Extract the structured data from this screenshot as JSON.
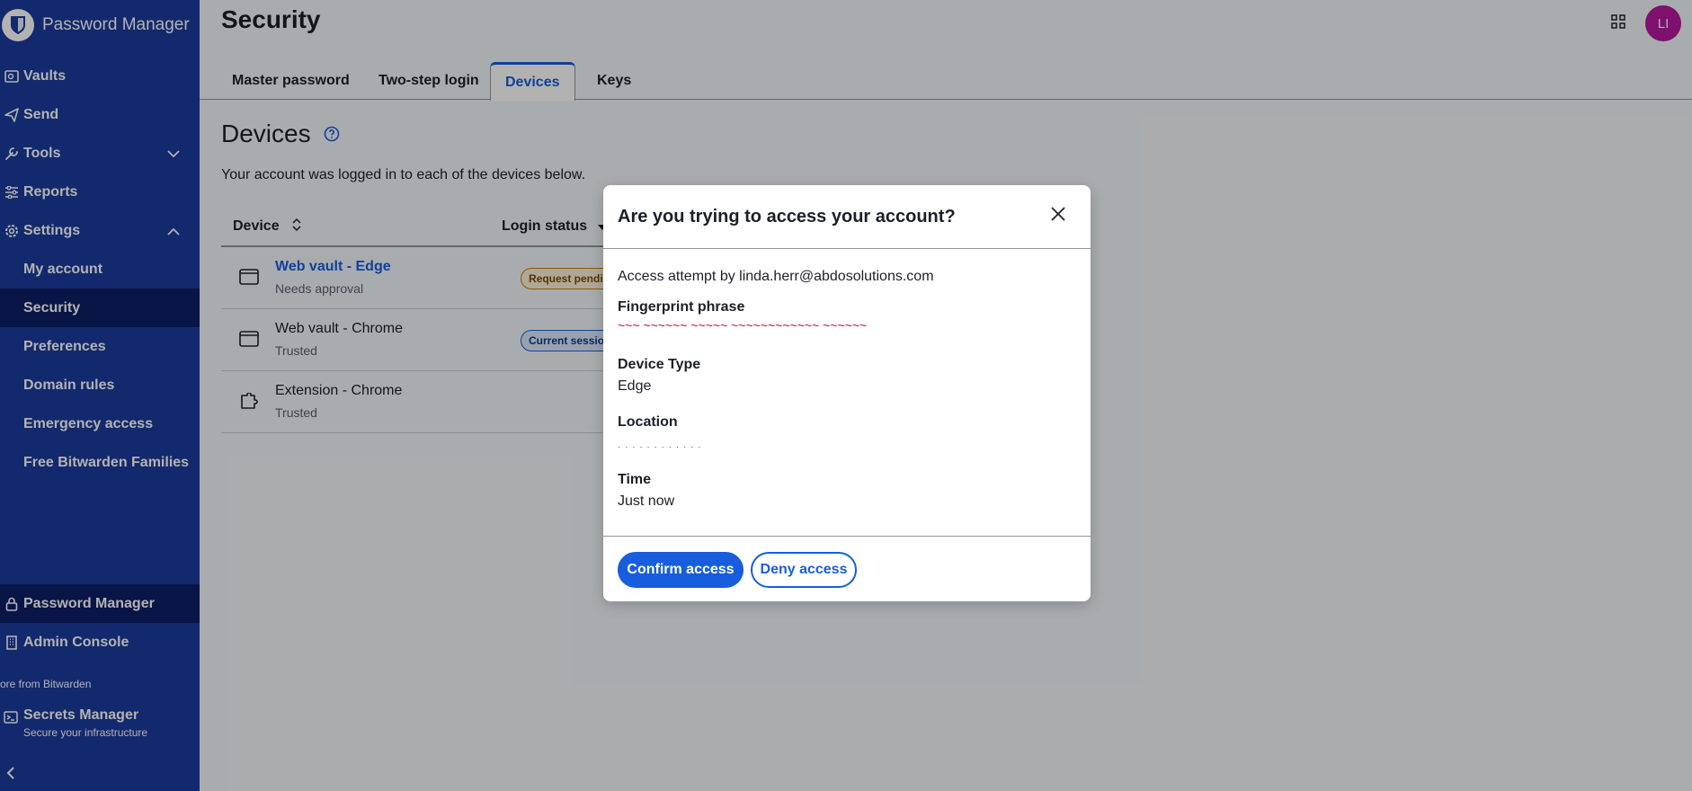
{
  "app": {
    "name": "Password Manager"
  },
  "sidebar": {
    "items": [
      {
        "label": "Vaults",
        "icon": "vault-icon"
      },
      {
        "label": "Send",
        "icon": "send-icon"
      },
      {
        "label": "Tools",
        "icon": "wrench-icon"
      },
      {
        "label": "Reports",
        "icon": "sliders-icon"
      },
      {
        "label": "Settings",
        "icon": "gear-icon"
      }
    ],
    "settings_sub": [
      "My account",
      "Security",
      "Preferences",
      "Domain rules",
      "Emergency access",
      "Free Bitwarden Families"
    ],
    "active_sub": "Security",
    "product_switcher": [
      {
        "label": "Password Manager",
        "icon": "lock-icon"
      },
      {
        "label": "Admin Console",
        "icon": "building-icon"
      }
    ],
    "more_from": "ore from Bitwarden",
    "secrets": {
      "title": "Secrets Manager",
      "subtitle": "Secure your infrastructure"
    }
  },
  "header": {
    "title": "Security",
    "avatar_initials": "LI"
  },
  "tabs": [
    "Master password",
    "Two-step login",
    "Devices",
    "Keys"
  ],
  "active_tab": "Devices",
  "devices": {
    "title": "Devices",
    "description": "Your account was logged in to each of the devices below.",
    "columns": [
      "Device",
      "Login status"
    ],
    "rows": [
      {
        "name": "Web vault - Edge",
        "sub": "Needs approval",
        "status": "Request pending",
        "status_type": "warning"
      },
      {
        "name": "Web vault - Chrome",
        "sub": "Trusted",
        "status": "Current session",
        "status_type": "info"
      },
      {
        "name": "Extension - Chrome",
        "sub": "Trusted",
        "status": "",
        "status_type": "none"
      }
    ]
  },
  "dialog": {
    "title": "Are you trying to access your account?",
    "access_attempt": "Access attempt by linda.herr@abdosolutions.com",
    "fingerprint_label": "Fingerprint phrase",
    "fingerprint_value": "~~~ ~~~~~~ ~~~~~ ~~~~~~~~~~~~ ~~~~~~",
    "device_type_label": "Device Type",
    "device_type_value": "Edge",
    "location_label": "Location",
    "location_value": "· · · · · · · · · · · ·",
    "time_label": "Time",
    "time_value": "Just now",
    "confirm_label": "Confirm access",
    "deny_label": "Deny access"
  },
  "colors": {
    "sidebar": "#1c3b9e",
    "accent": "#175ddc",
    "avatar": "#b5179e"
  }
}
